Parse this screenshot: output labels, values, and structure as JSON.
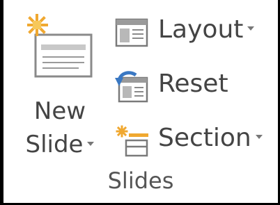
{
  "group": {
    "name": "Slides"
  },
  "new_slide": {
    "line1": "New",
    "line2": "Slide",
    "icon": "new-slide-icon"
  },
  "commands": {
    "layout": {
      "label": "Layout",
      "icon": "layout-icon",
      "has_dropdown": true
    },
    "reset": {
      "label": "Reset",
      "icon": "reset-icon",
      "has_dropdown": false
    },
    "section": {
      "label": "Section",
      "icon": "section-icon",
      "has_dropdown": true
    }
  },
  "colors": {
    "accent_orange": "#f0a830",
    "icon_gray": "#777777",
    "icon_blue": "#3a78c3",
    "text": "#444444"
  }
}
